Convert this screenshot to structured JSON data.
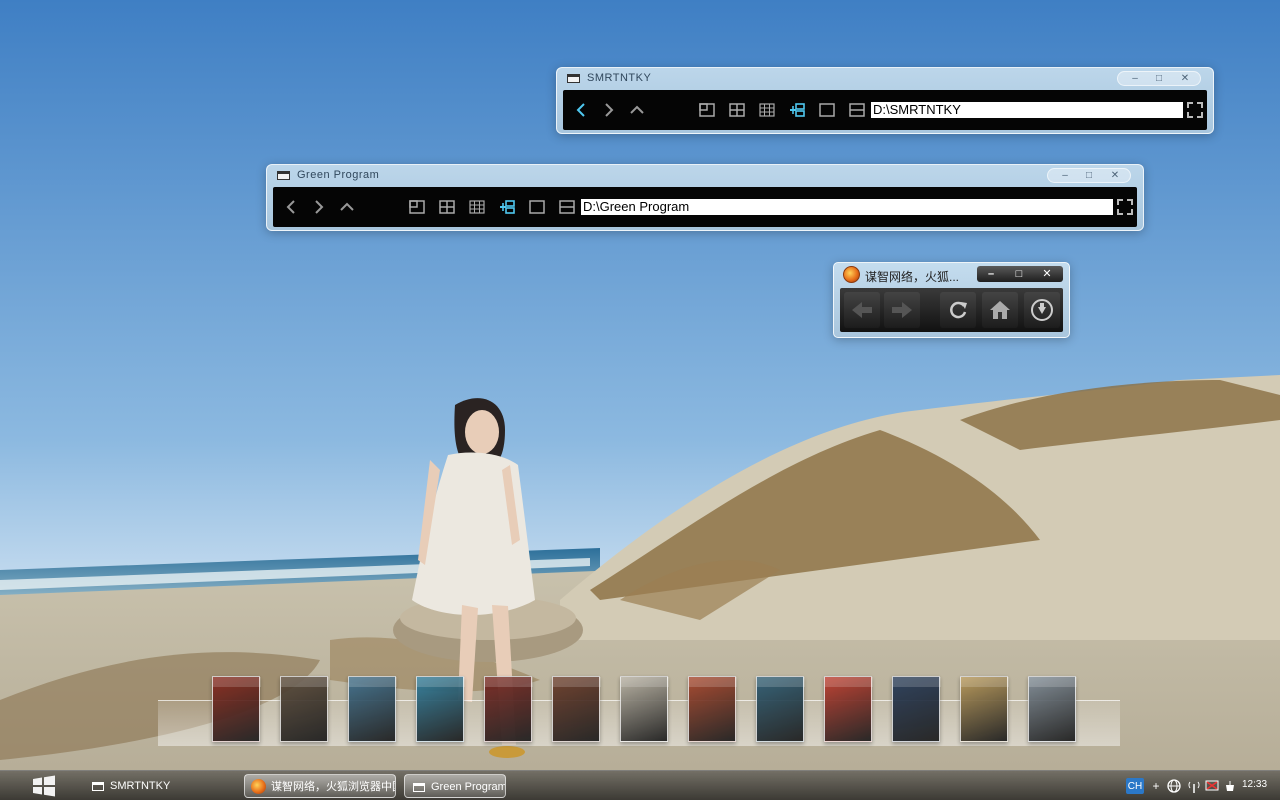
{
  "windows": [
    {
      "id": "smrtntky",
      "title": "SMRTNTKY",
      "address": "D:\\SMRTNTKY",
      "controls": [
        "minimize",
        "maximize",
        "close"
      ]
    },
    {
      "id": "green-program",
      "title": "Green Program",
      "address": "D:\\Green Program",
      "controls": [
        "minimize",
        "maximize",
        "close"
      ]
    }
  ],
  "firefox": {
    "title": "谋智网络，火狐...",
    "buttons": [
      "back-icon",
      "forward-icon",
      "reload-icon",
      "home-icon",
      "download-icon"
    ]
  },
  "dock": {
    "games": [
      {
        "name": "game-cover-1",
        "color": "#8b2a1f"
      },
      {
        "name": "game-cover-2",
        "color": "#5a4a3a"
      },
      {
        "name": "game-cover-3",
        "color": "#3d6f8e"
      },
      {
        "name": "game-cover-4",
        "color": "#2e7fa0"
      },
      {
        "name": "game-cover-5",
        "color": "#7a2620"
      },
      {
        "name": "game-cover-6",
        "color": "#6b3a28"
      },
      {
        "name": "game-cover-7",
        "color": "#b8b2a4"
      },
      {
        "name": "game-cover-8",
        "color": "#a8442a"
      },
      {
        "name": "game-cover-9",
        "color": "#2c5d76"
      },
      {
        "name": "game-cover-10",
        "color": "#c03a2c"
      },
      {
        "name": "game-cover-11",
        "color": "#243a5a"
      },
      {
        "name": "game-cover-12",
        "color": "#b89858"
      },
      {
        "name": "game-cover-13",
        "color": "#7f8c98"
      }
    ]
  },
  "taskbar": {
    "tasks": [
      {
        "label": "SMRTNTKY",
        "active": false
      },
      {
        "label": "谋智网络，火狐浏览器中国版...",
        "active": true
      },
      {
        "label": "Green Program",
        "active": true
      }
    ],
    "tray": {
      "language": "CH",
      "clock": "12:33"
    }
  },
  "colors": {
    "accent": "#4fc8f0",
    "toolbar": "#050505",
    "sky": "#5b95cf"
  }
}
